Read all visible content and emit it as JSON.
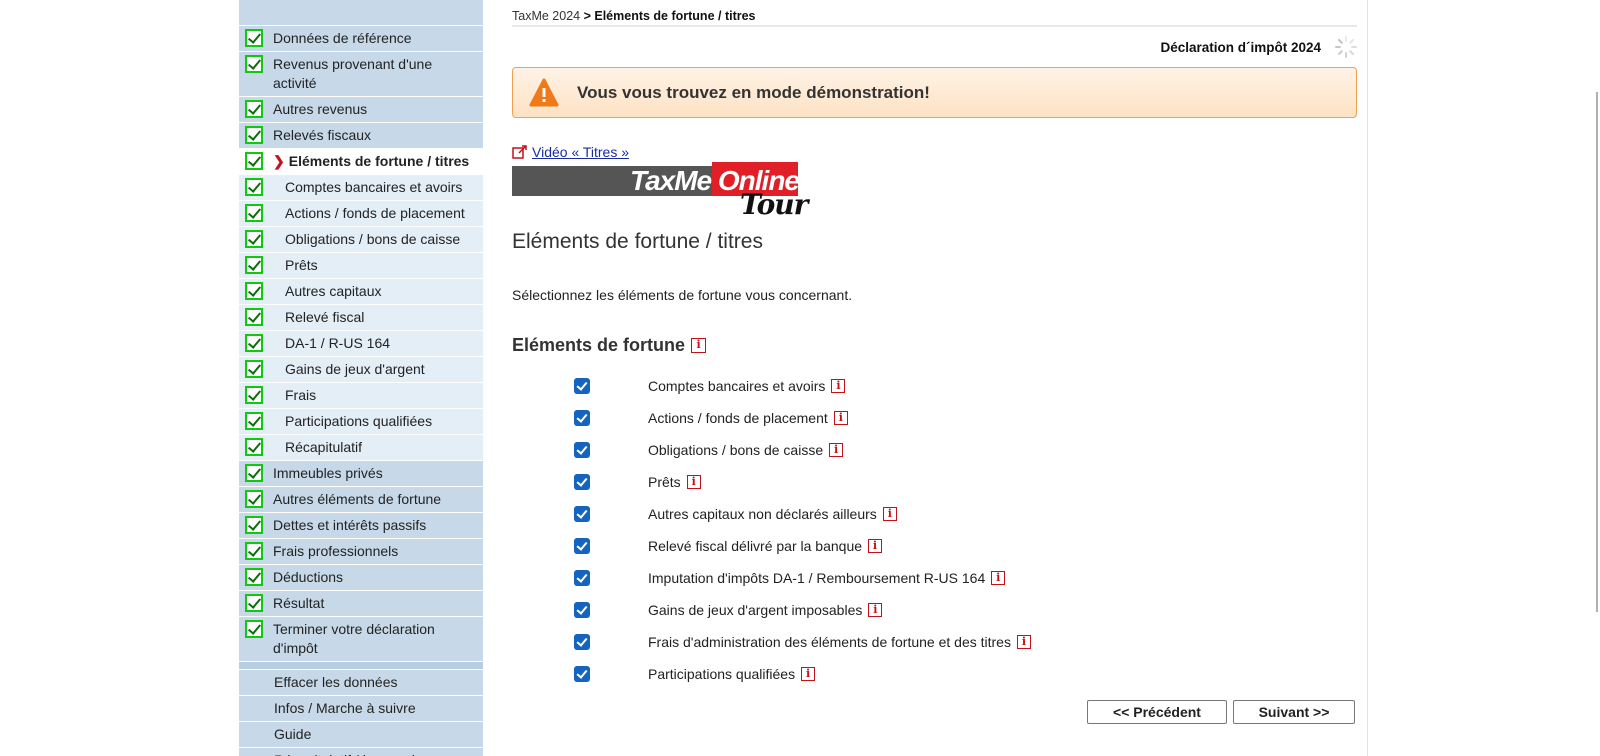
{
  "breadcrumb": {
    "root": "TaxMe 2024",
    "separator": " > ",
    "current": "Eléments de fortune / titres"
  },
  "declaration_label": "Déclaration d´impôt 2024",
  "demo_banner": "Vous vous trouvez en mode démonstration!",
  "video_link": "Vidéo « Titres »",
  "logo": {
    "text": "TaxMe Online",
    "tour": "Tour"
  },
  "page_title": "Eléments de fortune / titres",
  "intro": "Sélectionnez les éléments de fortune vous concernant.",
  "section_title": "Eléments de fortune",
  "info_glyph": "i",
  "active_marker": "❯",
  "sidebar": {
    "items": [
      {
        "label": "Données de référence",
        "type": "top"
      },
      {
        "label": "Revenus provenant d'une activité",
        "type": "top"
      },
      {
        "label": "Autres revenus",
        "type": "top"
      },
      {
        "label": "Relevés fiscaux",
        "type": "top"
      },
      {
        "label": "Eléments de fortune / titres",
        "type": "active"
      },
      {
        "label": "Comptes bancaires et avoirs",
        "type": "sub"
      },
      {
        "label": "Actions / fonds de placement",
        "type": "sub"
      },
      {
        "label": "Obligations / bons de caisse",
        "type": "sub"
      },
      {
        "label": "Prêts",
        "type": "sub"
      },
      {
        "label": "Autres capitaux",
        "type": "sub"
      },
      {
        "label": "Relevé fiscal",
        "type": "sub"
      },
      {
        "label": "DA-1 / R-US 164",
        "type": "sub"
      },
      {
        "label": "Gains de jeux d'argent",
        "type": "sub"
      },
      {
        "label": "Frais",
        "type": "sub"
      },
      {
        "label": "Participations qualifiées",
        "type": "sub"
      },
      {
        "label": "Récapitulatif",
        "type": "sub"
      },
      {
        "label": "Immeubles privés",
        "type": "top"
      },
      {
        "label": "Autres éléments de fortune",
        "type": "top"
      },
      {
        "label": "Dettes et intérêts passifs",
        "type": "top"
      },
      {
        "label": "Frais professionnels",
        "type": "top"
      },
      {
        "label": "Déductions",
        "type": "top"
      },
      {
        "label": "Résultat",
        "type": "top"
      },
      {
        "label": "Terminer votre déclaration d'impôt",
        "type": "top"
      }
    ],
    "utilities": [
      "Effacer les données",
      "Infos / Marche à suivre",
      "Guide",
      "Récapitulatif / impression"
    ]
  },
  "options": [
    {
      "label": "Comptes bancaires et avoirs",
      "checked": true
    },
    {
      "label": "Actions / fonds de placement",
      "checked": true
    },
    {
      "label": "Obligations / bons de caisse",
      "checked": true
    },
    {
      "label": "Prêts",
      "checked": true
    },
    {
      "label": "Autres capitaux non déclarés ailleurs",
      "checked": true
    },
    {
      "label": "Relevé fiscal délivré par la banque",
      "checked": true
    },
    {
      "label": "Imputation d'impôts DA-1 / Remboursement R-US 164",
      "checked": true
    },
    {
      "label": "Gains de jeux d'argent imposables",
      "checked": true
    },
    {
      "label": "Frais d'administration des éléments de fortune et des titres",
      "checked": true
    },
    {
      "label": "Participations qualifiées",
      "checked": true
    }
  ],
  "buttons": {
    "prev": "<< Précédent",
    "next": "Suivant >>"
  },
  "colors": {
    "sidebar": "#c7d9e9",
    "sub_item": "#e4eef7",
    "checkbox": "#1565c0",
    "info": "#c4121a",
    "banner_border": "#f0a050",
    "warning": "#f07a1a"
  }
}
